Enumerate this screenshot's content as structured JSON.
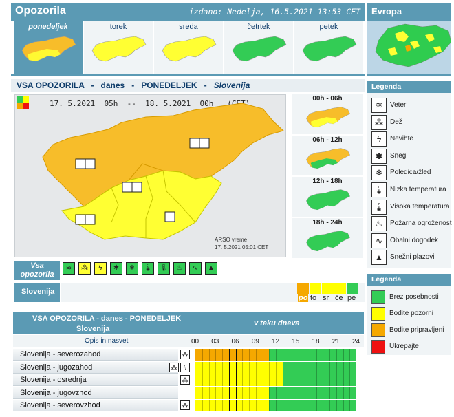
{
  "header": {
    "title": "Opozorila",
    "issued": "izdano: Nedelja, 16.5.2021 13:53 CET",
    "europe_label": "Evropa"
  },
  "days": [
    {
      "label": "ponedeljek",
      "selected": true,
      "level": "orange"
    },
    {
      "label": "torek",
      "selected": false,
      "level": "yellow"
    },
    {
      "label": "sreda",
      "selected": false,
      "level": "yellow"
    },
    {
      "label": "četrtek",
      "selected": false,
      "level": "green"
    },
    {
      "label": "petek",
      "selected": false,
      "level": "green"
    }
  ],
  "main": {
    "heading_part1": "VSA OPOZORILA",
    "heading_sep1": "-",
    "heading_part2": "danes",
    "heading_sep2": "-",
    "heading_part3": "PONEDELJEK",
    "heading_sep3": "-",
    "heading_part4": "Slovenija",
    "map_date": "17. 5.2021  05h  --  18. 5.2021  00h   (CET)",
    "credit_line1": "ARSO vreme",
    "credit_line2": "17. 5.2021  05:01 CET"
  },
  "time_slots": [
    "00h - 06h",
    "06h - 12h",
    "12h - 18h",
    "18h - 24h"
  ],
  "hazard_bar": {
    "label": "Vsa opozorila",
    "region_label": "Slovenija",
    "active_hazards": [
      "veter",
      "dez",
      "nevihte"
    ]
  },
  "day_selector": {
    "labels": [
      "po",
      "to",
      "sr",
      "če",
      "pe"
    ],
    "colors": [
      "#f5a800",
      "#ffff00",
      "#ffff00",
      "#ffff00",
      "#33cc55"
    ]
  },
  "legend": {
    "title": "Legenda",
    "items": [
      "Veter",
      "Dež",
      "Nevihte",
      "Sneg",
      "Poledica/žled",
      "Nizka temperatura",
      "Visoka temperatura",
      "Požarna ogroženost",
      "Obalni dogodek",
      "Snežni plazovi"
    ]
  },
  "legend_levels": {
    "title": "Legenda",
    "items": [
      {
        "label": "Brez posebnosti",
        "color": "#33cc55"
      },
      {
        "label": "Bodite pozorni",
        "color": "#ffff00"
      },
      {
        "label": "Bodite pripravljeni",
        "color": "#f5a800"
      },
      {
        "label": "Ukrepajte",
        "color": "#ee1111"
      }
    ]
  },
  "timeline": {
    "title": "VSA OPOZORILA - danes - PONEDELJEK",
    "subtitle": "Slovenija",
    "during_day": "v teku dneva",
    "desc_label": "Opis in nasveti",
    "hours": [
      "00",
      "03",
      "06",
      "09",
      "12",
      "15",
      "18",
      "21",
      "24"
    ],
    "now_hour": 5,
    "rows": [
      {
        "name": "Slovenija - severozahod",
        "icons": [
          "dez"
        ],
        "segments": [
          {
            "from": 0,
            "to": 11,
            "color": "#f5a800"
          },
          {
            "from": 11,
            "to": 24,
            "color": "#33cc55"
          }
        ]
      },
      {
        "name": "Slovenija - jugozahod",
        "icons": [
          "dez",
          "nevihte"
        ],
        "segments": [
          {
            "from": 0,
            "to": 13,
            "color": "#ffff00"
          },
          {
            "from": 13,
            "to": 24,
            "color": "#33cc55"
          }
        ]
      },
      {
        "name": "Slovenija - osrednja",
        "icons": [
          "dez"
        ],
        "segments": [
          {
            "from": 0,
            "to": 13,
            "color": "#ffff00"
          },
          {
            "from": 13,
            "to": 24,
            "color": "#33cc55"
          }
        ]
      },
      {
        "name": "Slovenija - jugovzhod",
        "icons": [],
        "segments": [
          {
            "from": 0,
            "to": 11,
            "color": "#ffff00"
          },
          {
            "from": 11,
            "to": 24,
            "color": "#33cc55"
          }
        ]
      },
      {
        "name": "Slovenija - severovzhod",
        "icons": [
          "dez"
        ],
        "segments": [
          {
            "from": 0,
            "to": 11,
            "color": "#ffff00"
          },
          {
            "from": 11,
            "to": 24,
            "color": "#33cc55"
          }
        ]
      }
    ]
  }
}
